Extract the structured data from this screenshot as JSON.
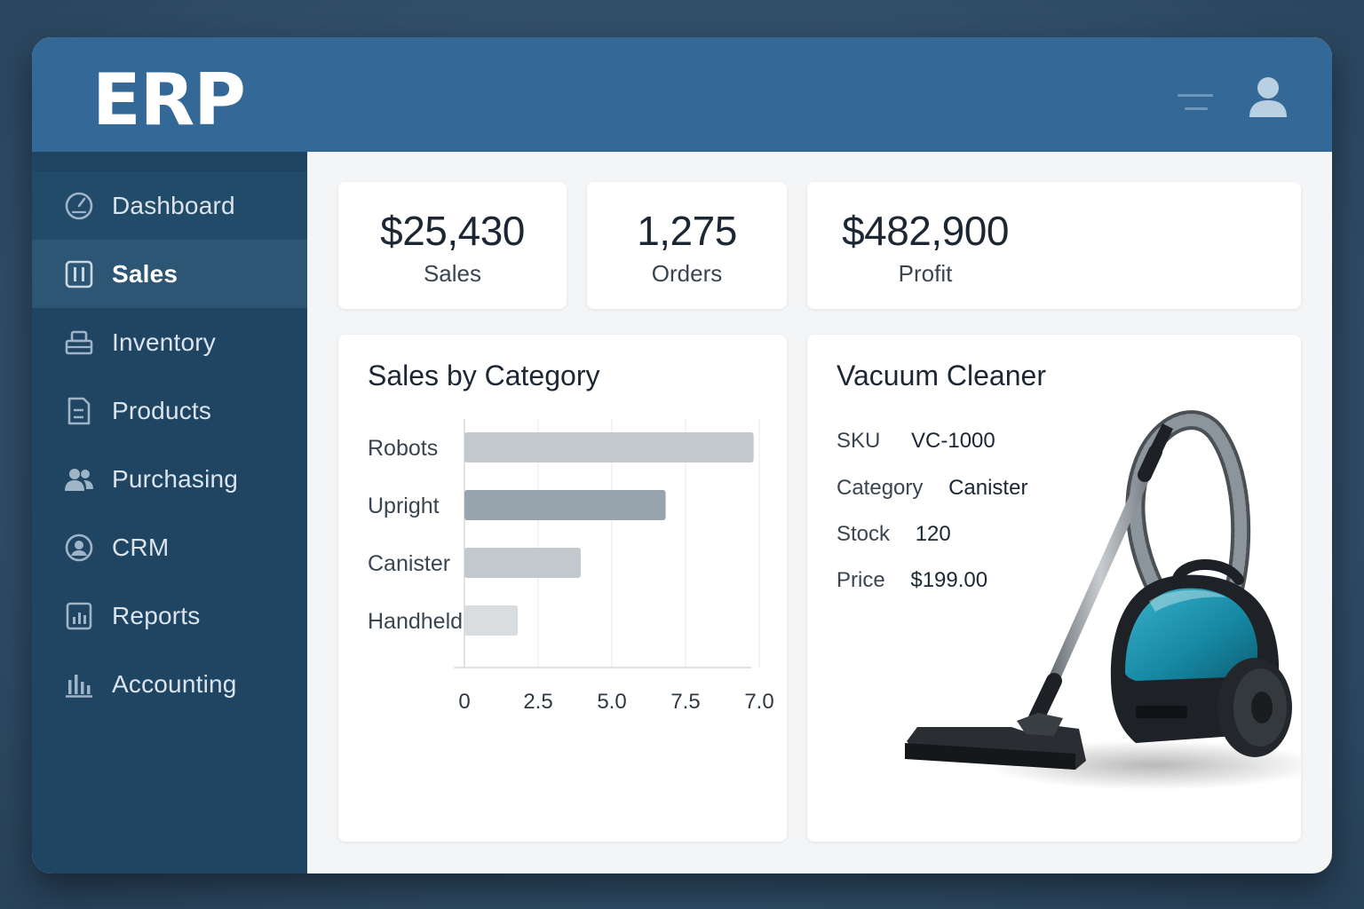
{
  "app": {
    "logo": "ERP"
  },
  "header": {
    "menu_icon": "menu-icon",
    "user_icon": "user-icon"
  },
  "sidebar": {
    "items": [
      {
        "label": "Dashboard",
        "icon": "gauge-icon"
      },
      {
        "label": "Sales",
        "icon": "sales-icon",
        "active": true
      },
      {
        "label": "Inventory",
        "icon": "inventory-icon"
      },
      {
        "label": "Products",
        "icon": "products-icon"
      },
      {
        "label": "Purchasing",
        "icon": "users-icon"
      },
      {
        "label": "CRM",
        "icon": "crm-icon"
      },
      {
        "label": "Reports",
        "icon": "reports-icon"
      },
      {
        "label": "Accounting",
        "icon": "bar-chart-icon"
      }
    ]
  },
  "kpis": [
    {
      "value": "$25,430",
      "label": "Sales"
    },
    {
      "value": "1,275",
      "label": "Orders"
    },
    {
      "value": "$482,900",
      "label": "Profit"
    }
  ],
  "chart_data": {
    "type": "bar",
    "orientation": "horizontal",
    "title": "Sales by Category",
    "categories": [
      "Robots",
      "Upright",
      "Canister",
      "Handheld"
    ],
    "values": [
      9.2,
      6.4,
      3.7,
      1.7
    ],
    "tick_labels": [
      "0",
      "2.5",
      "5.0",
      "7.5",
      "7.0"
    ],
    "xlim": [
      0,
      10
    ],
    "grid": true,
    "bar_colors": [
      "#c3c8cd",
      "#97a3ad",
      "#c3c8cd",
      "#dadde0"
    ]
  },
  "product": {
    "title": "Vacuum Cleaner",
    "fields": [
      {
        "label": "SKU",
        "value": "VC-1000"
      },
      {
        "label": "Category",
        "value": "Canister"
      },
      {
        "label": "Stock",
        "value": "120"
      },
      {
        "label": "Price",
        "value": "$199.00"
      }
    ],
    "image": "vacuum-cleaner-image"
  },
  "colors": {
    "header": "#346896",
    "sidebar": "#1f4563",
    "sidebar_active": "#2c5674",
    "product_accent": "#1a7f9a"
  }
}
